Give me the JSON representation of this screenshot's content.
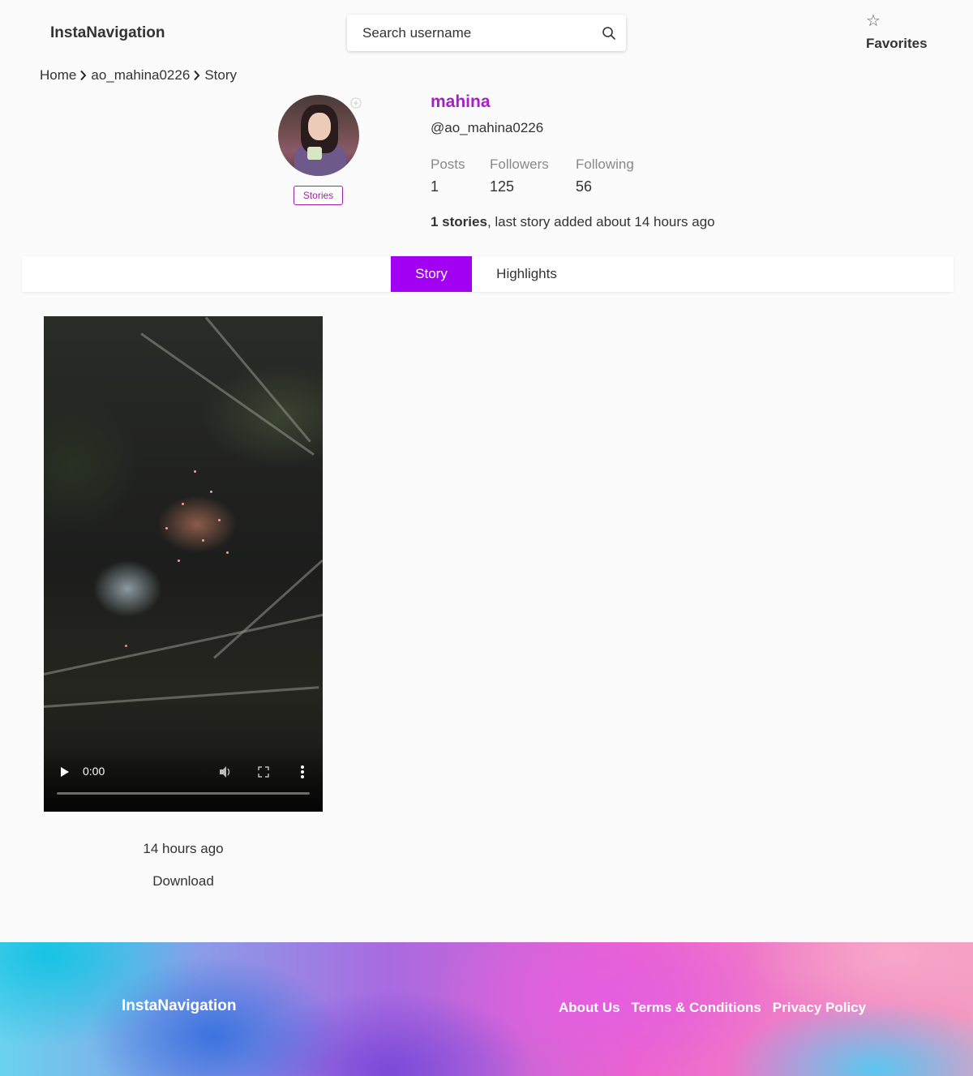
{
  "header": {
    "logo": "InstaNavigation",
    "search_placeholder": "Search username",
    "favorites_label": "Favorites",
    "favorites_icon": "☆"
  },
  "breadcrumb": {
    "items": [
      "Home",
      "ao_mahina0226",
      "Story"
    ]
  },
  "profile": {
    "name": "mahina",
    "handle": "@ao_mahina0226",
    "stories_button": "Stories",
    "stats": [
      {
        "label": "Posts",
        "value": "1"
      },
      {
        "label": "Followers",
        "value": "125"
      },
      {
        "label": "Following",
        "value": "56"
      }
    ],
    "summary_bold": "1 stories",
    "summary_rest": ", last story added about 14 hours ago"
  },
  "tabs": [
    {
      "label": "Story",
      "active": true
    },
    {
      "label": "Highlights",
      "active": false
    }
  ],
  "story": {
    "video_time": "0:00",
    "progress": 0,
    "posted": "14 hours ago",
    "download_label": "Download"
  },
  "footer": {
    "logo": "InstaNavigation",
    "links": [
      "About Us",
      "Terms & Conditions",
      "Privacy Policy"
    ]
  },
  "colors": {
    "accent_purple": "#a100f2",
    "name_color": "#a81fc8"
  }
}
